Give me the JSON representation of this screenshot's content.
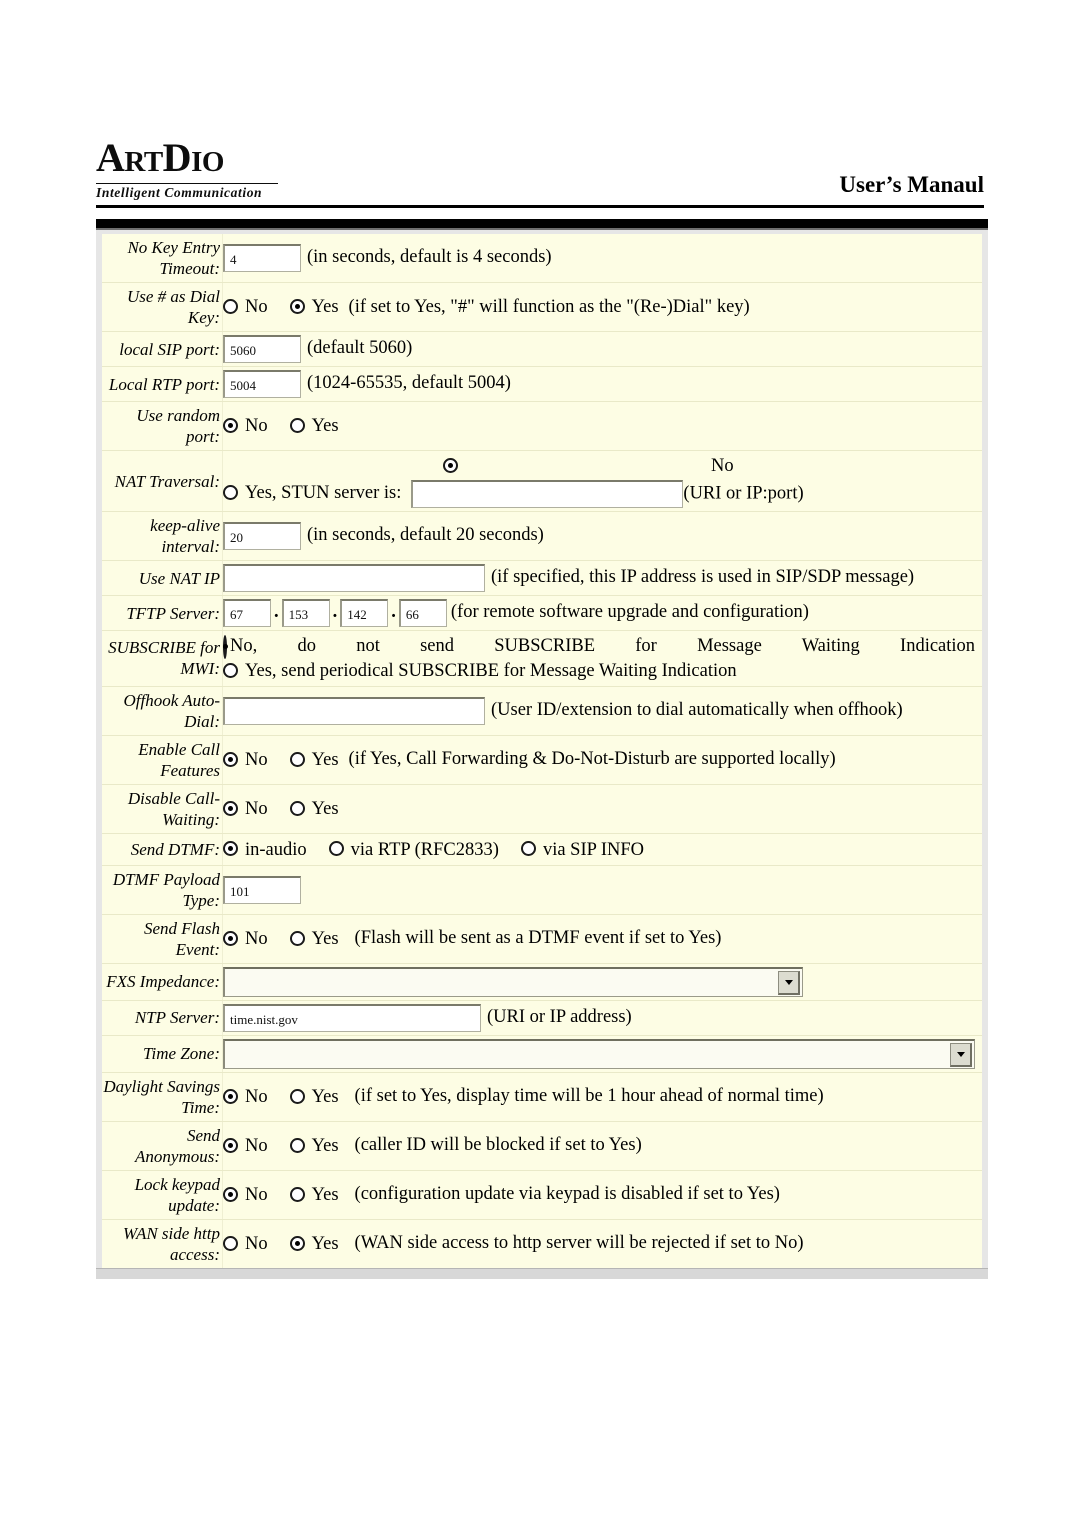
{
  "header": {
    "logo_main_a": "A",
    "logo_main_rt": "RT",
    "logo_main_d": "D",
    "logo_main_io": "IO",
    "logo_text": "ArtDio",
    "logo_tagline": "Intelligent Communication",
    "manual_title": "User’s Manaul"
  },
  "form": {
    "rows": [
      {
        "label": "No Key Entry Timeout:",
        "value": "4",
        "note": "(in seconds, default is 4 seconds)"
      },
      {
        "label": "Use # as Dial Key:",
        "option_no": "No",
        "option_yes": "Yes",
        "selected": "Yes",
        "note": "(if set to Yes, \"#\" will function as the \"(Re-)Dial\" key)"
      },
      {
        "label": "local SIP port:",
        "value": "5060",
        "note": "(default 5060)"
      },
      {
        "label": "Local RTP port:",
        "value": "5004",
        "note": "(1024-65535, default 5004)"
      },
      {
        "label": "Use random port:",
        "option_no": "No",
        "option_yes": "Yes",
        "selected": "No"
      },
      {
        "label": "NAT Traversal:",
        "option_no": "No",
        "option_yes": "Yes, STUN server is:",
        "selected": "No",
        "stun_value": "",
        "note": "(URI or IP:port)"
      },
      {
        "label": "keep-alive interval:",
        "value": "20",
        "note": "(in seconds, default 20 seconds)"
      },
      {
        "label": "Use NAT IP",
        "value": "",
        "note": "(if specified, this IP address is used in SIP/SDP message)"
      },
      {
        "label": "TFTP Server:",
        "octets": [
          "67",
          "153",
          "142",
          "66"
        ],
        "separator": ".",
        "note": "(for remote software upgrade and configuration)"
      },
      {
        "label": "SUBSCRIBE for MWI:",
        "option_no_words": [
          "No,",
          "do",
          "not",
          "send",
          "SUBSCRIBE",
          "for",
          "Message",
          "Waiting",
          "Indication"
        ],
        "option_yes": "Yes, send periodical SUBSCRIBE for Message Waiting Indication",
        "selected": "No"
      },
      {
        "label": "Offhook Auto-Dial:",
        "value": "",
        "note": "(User ID/extension to dial automatically when offhook)"
      },
      {
        "label": "Enable Call Features",
        "option_no": "No",
        "option_yes": "Yes",
        "selected": "No",
        "note": "(if Yes, Call Forwarding & Do-Not-Disturb are supported locally)"
      },
      {
        "label": "Disable Call-Waiting:",
        "option_no": "No",
        "option_yes": "Yes",
        "selected": "No"
      },
      {
        "label": "Send DTMF:",
        "option_1": "in-audio",
        "option_2": "via RTP (RFC2833)",
        "option_3": "via SIP INFO",
        "selected": "in-audio"
      },
      {
        "label": "DTMF Payload Type:",
        "value": "101"
      },
      {
        "label": "Send Flash Event:",
        "option_no": "No",
        "option_yes": "Yes",
        "selected": "No",
        "note": "(Flash will be sent as a DTMF event if set to Yes)"
      },
      {
        "label": "FXS Impedance:",
        "selected_option": ""
      },
      {
        "label": "NTP Server:",
        "value": "time.nist.gov",
        "note": "(URI or IP address)"
      },
      {
        "label": "Time Zone:",
        "selected_option": ""
      },
      {
        "label": "Daylight Savings Time:",
        "option_no": "No",
        "option_yes": "Yes",
        "selected": "No",
        "note": "(if set to Yes, display time will be 1 hour ahead of normal time)"
      },
      {
        "label": "Send Anonymous:",
        "option_no": "No",
        "option_yes": "Yes",
        "selected": "No",
        "note": "(caller ID will be blocked if set to Yes)"
      },
      {
        "label": "Lock keypad update:",
        "option_no": "No",
        "option_yes": "Yes",
        "selected": "No",
        "note": "(configuration update via keypad is disabled if set to Yes)"
      },
      {
        "label": "WAN side http access:",
        "option_no": "No",
        "option_yes": "Yes",
        "selected": "Yes",
        "note": "(WAN side access to http server will be rejected if set to No)"
      }
    ]
  },
  "colors": {
    "page_background": "#ffffff",
    "form_background": "#fdfde4",
    "frame_background": "#e6e6e6",
    "text": "#000000",
    "field_border": "#7a7a6a"
  }
}
